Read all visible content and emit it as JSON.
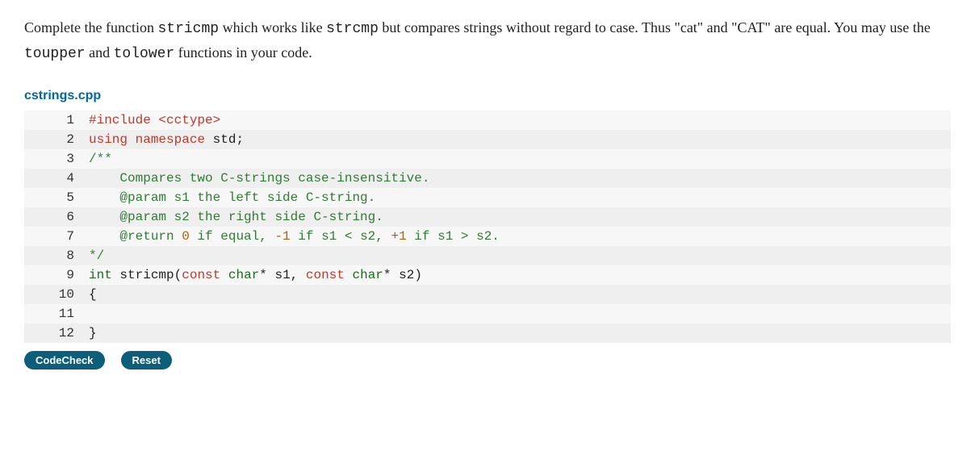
{
  "instruction": {
    "part1": "Complete the function ",
    "code1": "stricmp",
    "part2": " which works like ",
    "code2": "strcmp",
    "part3": " but compares strings without regard to case. Thus \"cat\" and \"CAT\" are equal. You may use the ",
    "code3": "toupper",
    "part4": " and ",
    "code4": "tolower",
    "part5": " functions in your code."
  },
  "filename": "cstrings.cpp",
  "code": {
    "line1": {
      "num": "1",
      "pp": "#include ",
      "inc": "<cctype>"
    },
    "line2": {
      "num": "2",
      "kw": "using ",
      "ns": "namespace",
      "rest": " std;"
    },
    "line3": {
      "num": "3",
      "text": "/**"
    },
    "line4": {
      "num": "4",
      "text": "    Compares two C-strings case-insensitive."
    },
    "line5": {
      "num": "5",
      "text": "    @param s1 the left side C-string."
    },
    "line6": {
      "num": "6",
      "text": "    @param s2 the right side C-string."
    },
    "line7": {
      "num": "7",
      "prefix": "    @return ",
      "zero": "0",
      "mid1": " if equal, ",
      "neg1": "-1",
      "mid2": " if s1 < s2, ",
      "pos1": "+1",
      "mid3": " if s1 > s2."
    },
    "line8": {
      "num": "8",
      "text": "*/"
    },
    "line9": {
      "num": "9",
      "ret": "int",
      "sp1": " ",
      "fn": "stricmp(",
      "const1": "const",
      "sp2": " ",
      "type1": "char",
      "ptr1": "* s1, ",
      "const2": "const",
      "sp3": " ",
      "type2": "char",
      "ptr2": "* s2)"
    },
    "line10": {
      "num": "10",
      "text": "{"
    },
    "line11": {
      "num": "11",
      "text": ""
    },
    "line12": {
      "num": "12",
      "text": "}"
    }
  },
  "buttons": {
    "codecheck": "CodeCheck",
    "reset": "Reset"
  }
}
